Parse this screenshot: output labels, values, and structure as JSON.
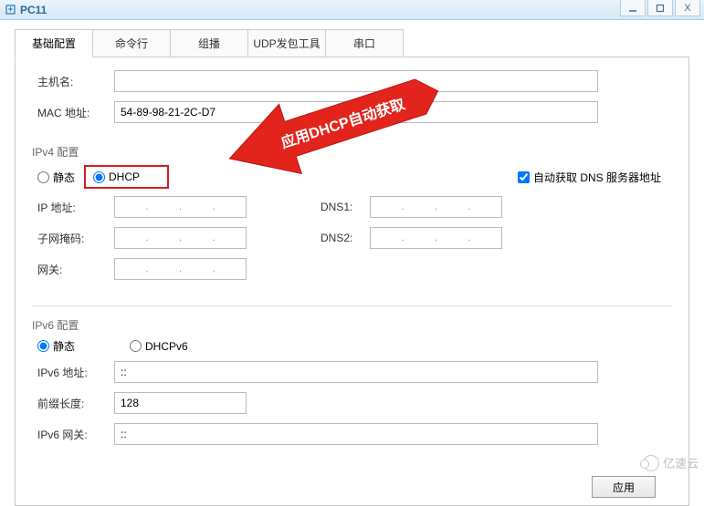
{
  "window": {
    "title": "PC11",
    "controls": {
      "min": "_",
      "max": "□",
      "close": "X"
    }
  },
  "tabs": [
    "基础配置",
    "命令行",
    "组播",
    "UDP发包工具",
    "串口"
  ],
  "active_tab": 0,
  "basic": {
    "host_label": "主机名:",
    "host_value": "",
    "mac_label": "MAC 地址:",
    "mac_value": "54-89-98-21-2C-D7"
  },
  "ipv4": {
    "section": "IPv4 配置",
    "static_label": "静态",
    "dhcp_label": "DHCP",
    "mode": "dhcp",
    "auto_dns_label": "自动获取 DNS 服务器地址",
    "auto_dns_checked": true,
    "ip_label": "IP 地址:",
    "mask_label": "子网掩码:",
    "gw_label": "网关:",
    "dns1_label": "DNS1:",
    "dns2_label": "DNS2:"
  },
  "ipv6": {
    "section": "IPv6 配置",
    "static_label": "静态",
    "dhcpv6_label": "DHCPv6",
    "mode": "static",
    "addr_label": "IPv6 地址:",
    "addr_value": "::",
    "prefix_label": "前缀长度:",
    "prefix_value": "128",
    "gw_label": "IPv6 网关:",
    "gw_value": "::"
  },
  "apply_label": "应用",
  "annotation": "应用DHCP自动获取",
  "watermark": "亿速云"
}
